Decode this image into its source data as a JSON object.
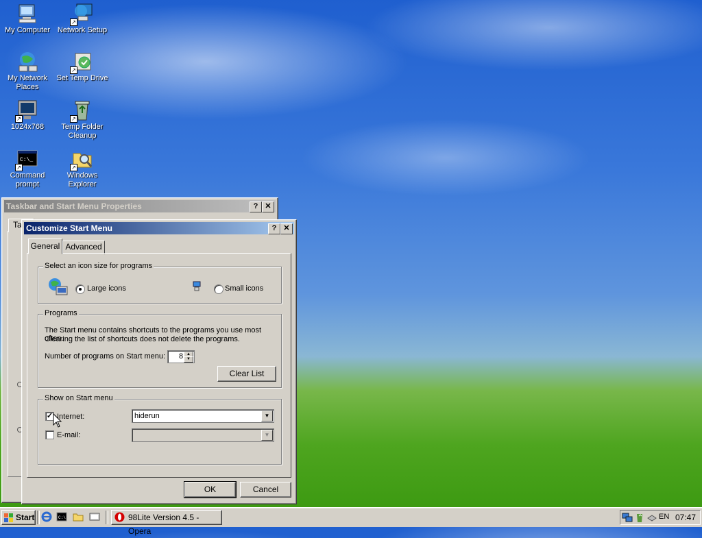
{
  "desktop": {
    "icons": [
      {
        "label_line1": "My Computer",
        "label_line2": "",
        "icon": "my-computer-icon"
      },
      {
        "label_line1": "Network Setup",
        "label_line2": "",
        "icon": "network-setup-icon"
      },
      {
        "label_line1": "My Network",
        "label_line2": "Places",
        "icon": "network-places-icon"
      },
      {
        "label_line1": "Set Temp Drive",
        "label_line2": "",
        "icon": "set-temp-drive-icon"
      },
      {
        "label_line1": "1024x768",
        "label_line2": "",
        "icon": "monitor-icon"
      },
      {
        "label_line1": "Temp Folder",
        "label_line2": "Cleanup",
        "icon": "recycle-icon"
      },
      {
        "label_line1": "Command",
        "label_line2": "prompt",
        "icon": "command-prompt-icon"
      },
      {
        "label_line1": "Windows",
        "label_line2": "Explorer",
        "icon": "windows-explorer-icon"
      }
    ]
  },
  "back_dialog": {
    "title": "Taskbar and Start Menu Properties",
    "help": "?",
    "close": "✕",
    "tab_fragment": "Ta"
  },
  "dialog": {
    "title": "Customize Start Menu",
    "help": "?",
    "close": "✕",
    "tabs": [
      "General",
      "Advanced"
    ],
    "icon_size": {
      "legend": "Select an icon size for programs",
      "large_label": "Large icons",
      "small_label": "Small icons",
      "selected": "Large icons"
    },
    "programs": {
      "legend": "Programs",
      "description_line1": "The Start menu contains shortcuts to the programs you use most often.",
      "description_line2": "Clearing the list of shortcuts does not delete the programs.",
      "count_label": "Number of programs on Start menu:",
      "count_value": "8",
      "clear_button": "Clear List"
    },
    "show_on_start": {
      "legend": "Show on Start menu",
      "internet_label": "Internet:",
      "internet_checked": true,
      "internet_value": "hiderun",
      "email_label": "E-mail:",
      "email_checked": false,
      "email_value": ""
    },
    "ok": "OK",
    "cancel": "Cancel"
  },
  "taskbar": {
    "start": "Start",
    "task_label": "98Lite Version 4.5 - Opera",
    "lang": "EN",
    "clock": "07:47"
  }
}
